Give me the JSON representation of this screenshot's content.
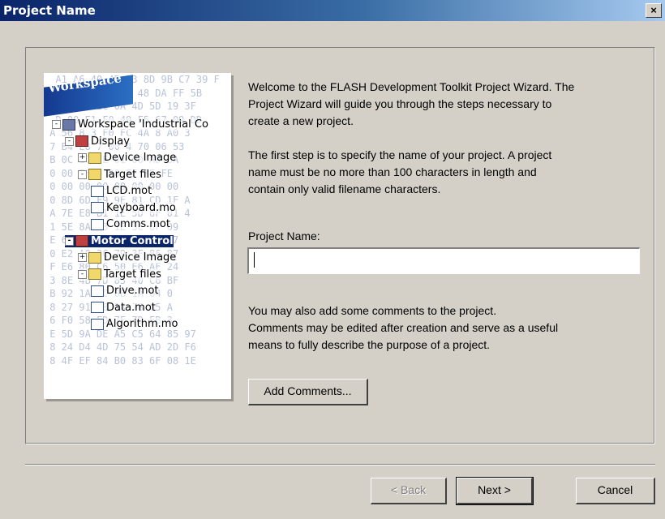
{
  "window": {
    "title": "Project Name",
    "close_glyph": "×"
  },
  "artwork": {
    "workspace_label": "Workspace",
    "hex_lines": [
      "  A1 A6 40 4B B3 8D 9B C7 39 F",
      "  B  61 8 C9 31 48 DA FF 5B",
      " 7 2A 9A 2C 0A 4D 5D 19 3F",
      "  D 00 E1 F0 49 F5 67 09 DD",
      " A 56 8 3 F0 FC 4A 8 A0 3",
      " 7 B4 E8 7 00 4 70 06 53",
      " B 0C EC FE 01 00 AD BA",
      " 0 00 FF 0 D0 FF FF FE",
      " 0 00 00 00 00 00 00 00",
      " 0 8D 6D F9 9E 81 CD 1F A",
      " A 7E E8 B1 1E 5D 6F 01 4",
      " 1 5E 8A 33 1E 3C 6F 09",
      " E 6A 81 5C 50 1A 90 97",
      " 0 E2 A0 3C 79 3F 86 87",
      " F E6 80 C6 50 E6 AF 24",
      " 3 8E 4B 7D 85 40 C6 BF",
      " B 92 1A 2C 0B 1A 64 0",
      " 8 27 91 08 1A 78 05 A",
      " 6 F0 58 FD 7F 7D FB 3",
      " E 5D 9A DE A5 C5 64 85 97",
      " 8 24 D4 4D 75 54 AD 2D F6",
      " 8 4F EF 84 B0 83 6F 08 1E"
    ],
    "tree": [
      {
        "label": "Workspace 'Industrial Co",
        "icon": "workspace-icon",
        "exp": "-",
        "level": 0
      },
      {
        "label": "Display",
        "icon": "project-icon",
        "exp": "-",
        "level": 1
      },
      {
        "label": "Device Image",
        "icon": "folder-icon",
        "exp": "+",
        "level": 2
      },
      {
        "label": "Target files",
        "icon": "folder-icon",
        "exp": "-",
        "level": 2
      },
      {
        "label": "LCD.mot",
        "icon": "file-icon",
        "exp": "",
        "level": 3
      },
      {
        "label": "Keyboard.mo",
        "icon": "file-icon",
        "exp": "",
        "level": 3
      },
      {
        "label": "Comms.mot",
        "icon": "file-icon",
        "exp": "",
        "level": 3
      },
      {
        "label": "Motor Control",
        "icon": "project-icon",
        "exp": "-",
        "level": 1,
        "highlight": true
      },
      {
        "label": "Device Image",
        "icon": "folder-icon",
        "exp": "+",
        "level": 2
      },
      {
        "label": "Target files",
        "icon": "folder-icon",
        "exp": "-",
        "level": 2
      },
      {
        "label": "Drive.mot",
        "icon": "file-icon",
        "exp": "",
        "level": 3
      },
      {
        "label": "Data.mot",
        "icon": "file-icon",
        "exp": "",
        "level": 3
      },
      {
        "label": "Algorithm.mo",
        "icon": "file-icon",
        "exp": "",
        "level": 3
      }
    ]
  },
  "intro": {
    "lines": [
      "Welcome to the FLASH Development Toolkit Project Wizard. The",
      "Project Wizard will guide you through the steps necessary to",
      "create a new project."
    ]
  },
  "step": {
    "lines": [
      "The first step is to specify the name of your project. A project",
      "name must be no more than 100 characters in length and",
      "contain only valid filename characters."
    ]
  },
  "project_name": {
    "label": "Project Name:",
    "value": "",
    "placeholder": ""
  },
  "comments": {
    "lines": [
      "You may also add some comments to the project.",
      "Comments may be edited after creation and serve as a useful",
      "means to fully describe the purpose of a project."
    ],
    "button_label": "Add Comments..."
  },
  "buttons": {
    "back": "< Back",
    "next": "Next >",
    "cancel": "Cancel"
  }
}
